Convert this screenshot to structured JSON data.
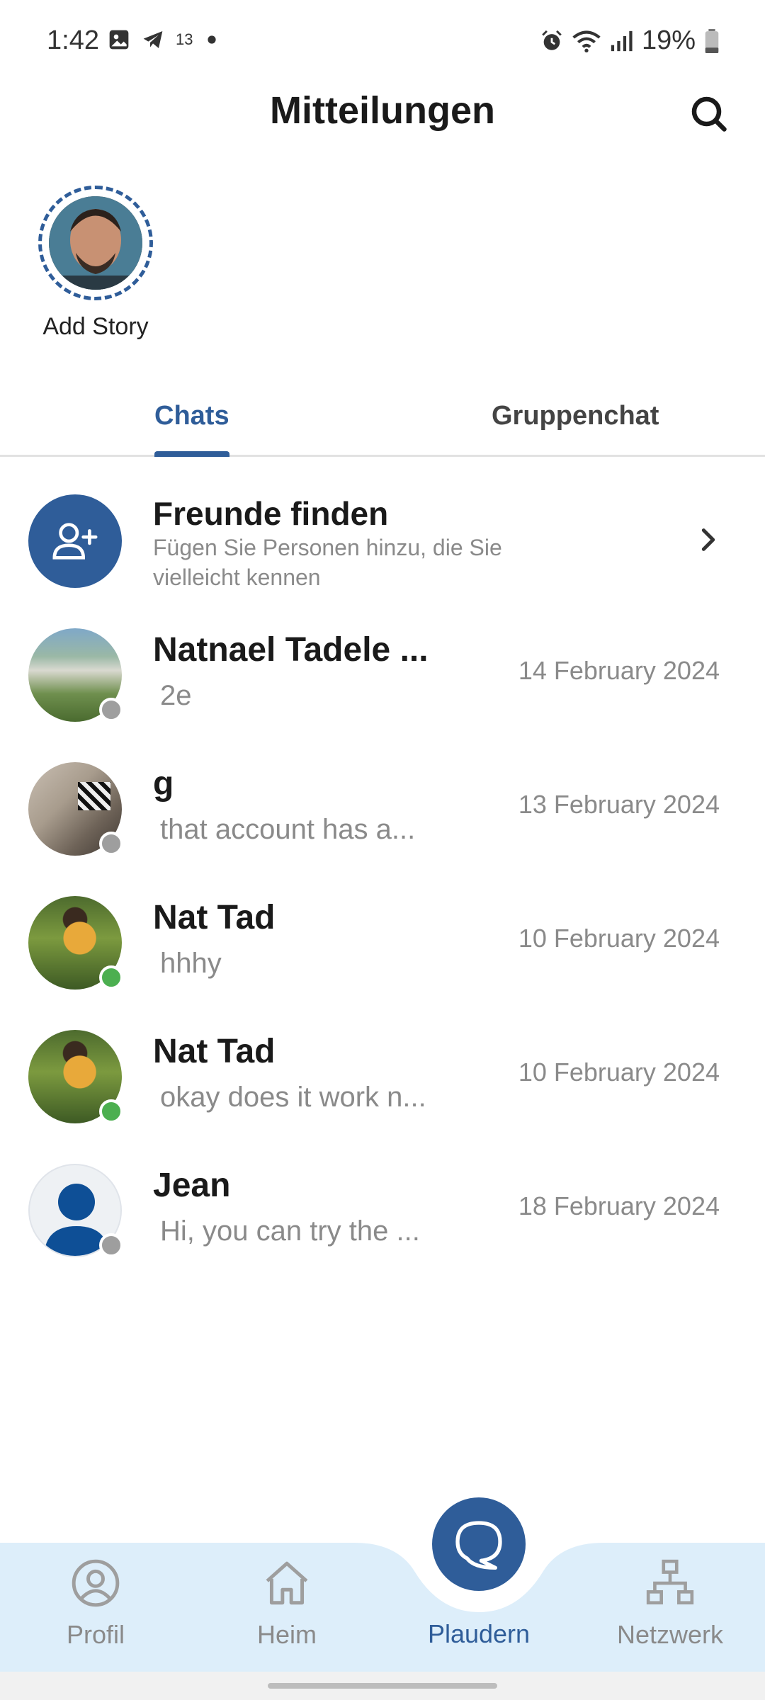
{
  "status_bar": {
    "time": "1:42",
    "battery_percent": "19%",
    "notification_badge": "13"
  },
  "header": {
    "title": "Mitteilungen"
  },
  "story": {
    "label": "Add Story"
  },
  "tabs": [
    {
      "label": "Chats",
      "active": true
    },
    {
      "label": "Gruppenchat",
      "active": false
    }
  ],
  "find_friends": {
    "title": "Freunde finden",
    "subtitle": "Fügen Sie Personen hinzu, die Sie vielleicht kennen"
  },
  "chats": [
    {
      "name": "Natnael Tadele ...",
      "message": "2e",
      "date": "14 February 2024",
      "status": "offline",
      "avatar": "waterfall-photo"
    },
    {
      "name": "g",
      "message": "that account has a...",
      "date": "13 February 2024",
      "status": "offline",
      "avatar": "room-photo"
    },
    {
      "name": "Nat Tad",
      "message": "hhhy",
      "date": "10 February 2024",
      "status": "online",
      "avatar": "photographer-photo"
    },
    {
      "name": "Nat Tad",
      "message": "okay does it work n...",
      "date": "10 February 2024",
      "status": "online",
      "avatar": "photographer-photo"
    },
    {
      "name": "Jean",
      "message": "Hi, you can try the ...",
      "date": "18 February 2024",
      "status": "offline",
      "avatar": "default-person"
    }
  ],
  "bottom_nav": [
    {
      "label": "Profil",
      "icon": "profile-icon",
      "active": false
    },
    {
      "label": "Heim",
      "icon": "home-icon",
      "active": false
    },
    {
      "label": "Plaudern",
      "icon": "chat-bubble-icon",
      "active": true
    },
    {
      "label": "Netzwerk",
      "icon": "network-icon",
      "active": false
    }
  ],
  "colors": {
    "primary": "#2f5d99",
    "nav_background": "#ddeefa",
    "online": "#4caf50",
    "offline": "#9e9e9e",
    "muted_text": "#8a8a8a"
  }
}
